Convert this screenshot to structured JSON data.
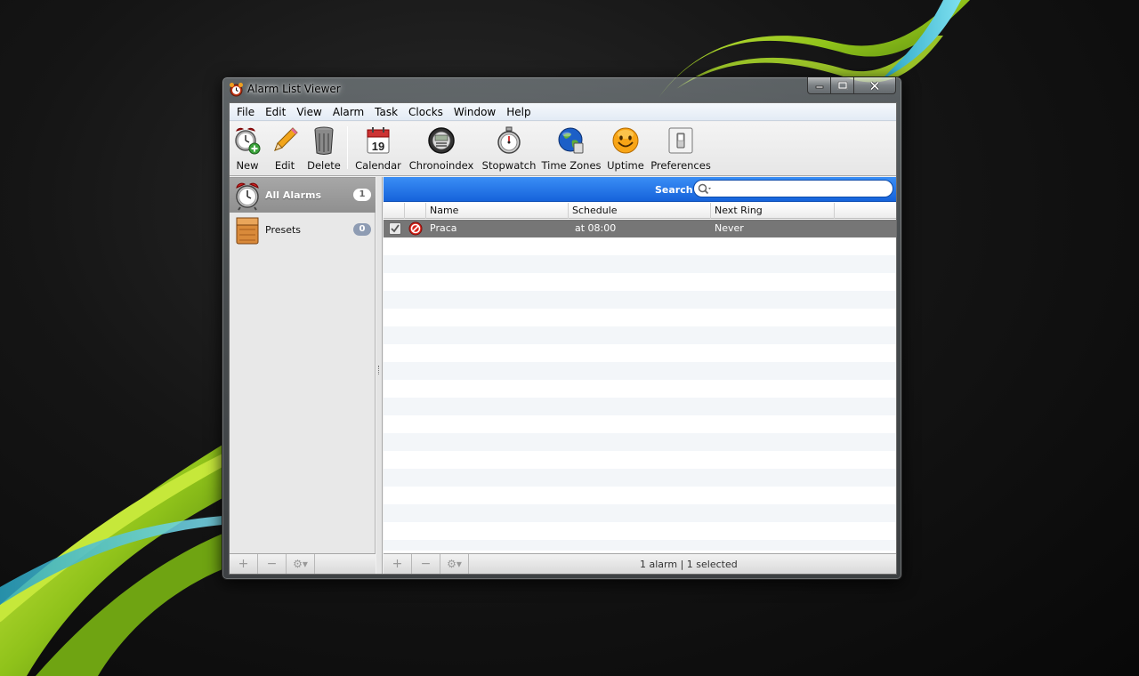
{
  "window": {
    "title": "Alarm List Viewer"
  },
  "menu": [
    "File",
    "Edit",
    "View",
    "Alarm",
    "Task",
    "Clocks",
    "Window",
    "Help"
  ],
  "toolbar": {
    "buttons": [
      {
        "label": "New",
        "icon": "alarm-clock-plus-icon"
      },
      {
        "label": "Edit",
        "icon": "pencil-icon"
      },
      {
        "label": "Delete",
        "icon": "trash-can-icon"
      },
      {
        "label": "Calendar",
        "icon": "calendar-icon"
      },
      {
        "label": "Chronoindex",
        "icon": "chronoindex-icon"
      },
      {
        "label": "Stopwatch",
        "icon": "stopwatch-icon"
      },
      {
        "label": "Time Zones",
        "icon": "globe-icon"
      },
      {
        "label": "Uptime",
        "icon": "smiley-icon"
      },
      {
        "label": "Preferences",
        "icon": "switch-icon"
      }
    ],
    "calendar_day": "19"
  },
  "sidebar": {
    "items": [
      {
        "label": "All Alarms",
        "count": "1",
        "icon": "alarm-clock-icon",
        "selected": true
      },
      {
        "label": "Presets",
        "count": "0",
        "icon": "box-icon",
        "selected": false
      }
    ]
  },
  "search": {
    "label": "Search",
    "placeholder": "",
    "value": ""
  },
  "table": {
    "columns": [
      "Name",
      "Schedule",
      "Next Ring"
    ],
    "rows": [
      {
        "enabled": true,
        "status_icon": "no-entry-icon",
        "name": "Praca",
        "schedule": "at 08:00",
        "next_ring": "Never"
      }
    ]
  },
  "bottom": {
    "add": "+",
    "remove": "−",
    "gear": "⚙▾",
    "status": "1 alarm | 1 selected"
  },
  "colors": {
    "search_bar": "#1f6fe8",
    "selected_row": "#767676",
    "accent_green": "#9ed11c"
  }
}
